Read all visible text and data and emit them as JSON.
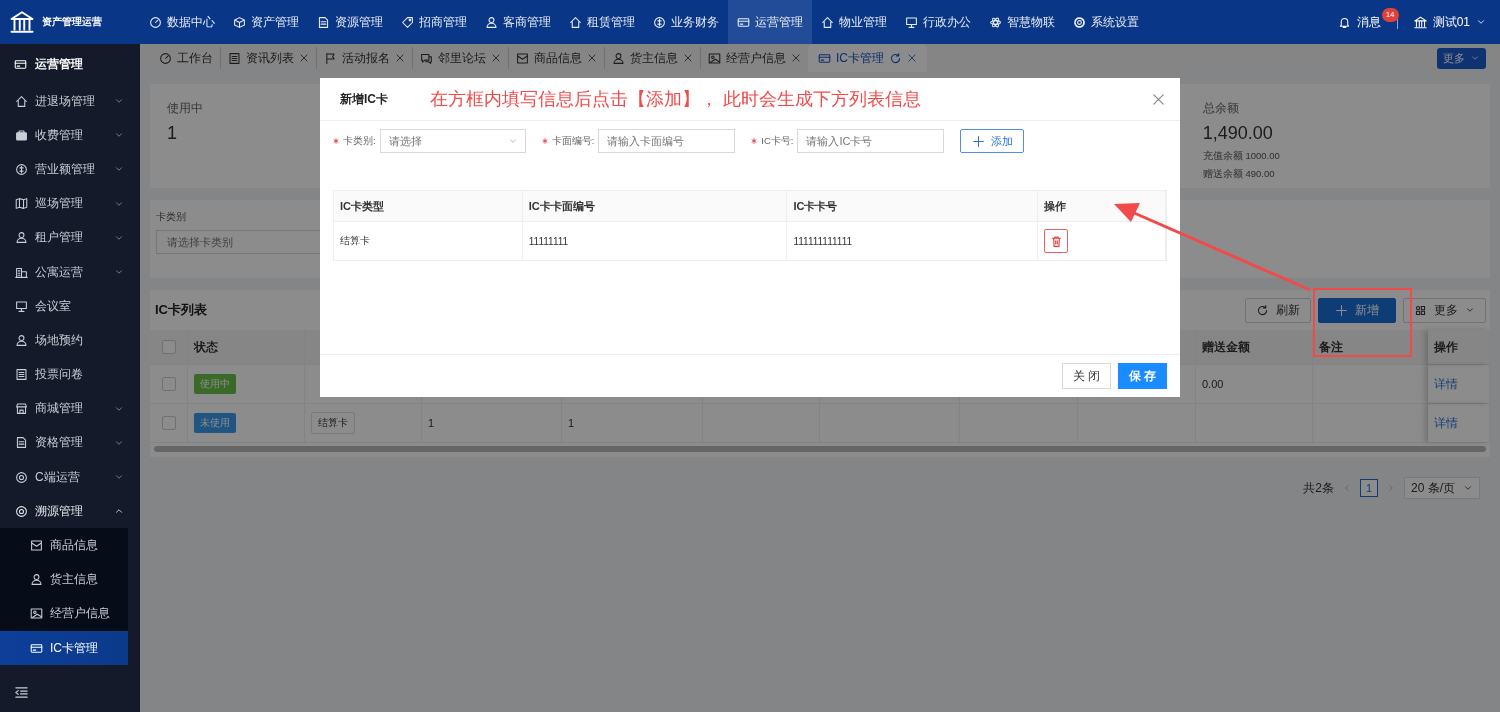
{
  "app": {
    "title": "资产管理运营"
  },
  "top_nav": [
    {
      "label": "数据中心",
      "selected": false
    },
    {
      "label": "资产管理",
      "selected": false
    },
    {
      "label": "资源管理",
      "selected": false
    },
    {
      "label": "招商管理",
      "selected": false
    },
    {
      "label": "客商管理",
      "selected": false
    },
    {
      "label": "租赁管理",
      "selected": false
    },
    {
      "label": "业务财务",
      "selected": false
    },
    {
      "label": "运营管理",
      "selected": true
    },
    {
      "label": "物业管理",
      "selected": false
    },
    {
      "label": "行政办公",
      "selected": false
    },
    {
      "label": "智慧物联",
      "selected": false
    },
    {
      "label": "系统设置",
      "selected": false
    }
  ],
  "messages": {
    "label": "消息",
    "badge": "14"
  },
  "user": {
    "name": "测试01"
  },
  "sidebar": {
    "title": "运营管理",
    "items": [
      {
        "label": "进退场管理",
        "kind": "group",
        "expanded": false
      },
      {
        "label": "收费管理",
        "kind": "group",
        "expanded": false
      },
      {
        "label": "营业额管理",
        "kind": "group",
        "expanded": false
      },
      {
        "label": "巡场管理",
        "kind": "group",
        "expanded": false
      },
      {
        "label": "租户管理",
        "kind": "group",
        "expanded": false
      },
      {
        "label": "公寓运营",
        "kind": "group",
        "expanded": false
      },
      {
        "label": "会议室",
        "kind": "link",
        "expanded": false
      },
      {
        "label": "场地预约",
        "kind": "link",
        "expanded": false
      },
      {
        "label": "投票问卷",
        "kind": "link",
        "expanded": false
      },
      {
        "label": "商城管理",
        "kind": "group",
        "expanded": false
      },
      {
        "label": "资格管理",
        "kind": "group",
        "expanded": false
      },
      {
        "label": "C端运营",
        "kind": "group",
        "expanded": false
      },
      {
        "label": "溯源管理",
        "kind": "group",
        "expanded": true,
        "children": [
          {
            "label": "商品信息",
            "selected": false
          },
          {
            "label": "货主信息",
            "selected": false
          },
          {
            "label": "经营户信息",
            "selected": false
          },
          {
            "label": "IC卡管理",
            "selected": true
          }
        ]
      }
    ]
  },
  "tabs": [
    {
      "label": "工作台",
      "closable": false,
      "selected": false
    },
    {
      "label": "资讯列表",
      "closable": true,
      "selected": false
    },
    {
      "label": "活动报名",
      "closable": true,
      "selected": false
    },
    {
      "label": "邻里论坛",
      "closable": true,
      "selected": false
    },
    {
      "label": "商品信息",
      "closable": true,
      "selected": false
    },
    {
      "label": "货主信息",
      "closable": true,
      "selected": false
    },
    {
      "label": "经营户信息",
      "closable": true,
      "selected": false
    },
    {
      "label": "IC卡管理",
      "closable": true,
      "selected": true
    }
  ],
  "tabs_more": "更多",
  "stats": [
    {
      "label": "使用中",
      "value": "1"
    },
    {
      "label": "总余额",
      "value": "1,490.00",
      "details": [
        "充值余额 1000.00",
        "赠送余额 490.00"
      ]
    }
  ],
  "filter": {
    "label": "卡类别",
    "placeholder": "请选择卡类别"
  },
  "card_list": {
    "title": "IC卡列表",
    "buttons": [
      {
        "label": "刷新",
        "kind": "refresh"
      },
      {
        "label": "新增",
        "kind": "primary"
      },
      {
        "label": "更多",
        "kind": "more"
      }
    ],
    "header": {
      "checked": false,
      "status": "状态",
      "gift_amount": "赠送金额",
      "remark": "备注",
      "action": "操作"
    },
    "rows": [
      {
        "checked": false,
        "status": {
          "label": "使用中",
          "kind": "in_use"
        },
        "gift_amount": "0.00",
        "action": "详情"
      },
      {
        "checked": false,
        "status": {
          "label": "未使用",
          "kind": "unused"
        },
        "card_type": "结算卡",
        "col_3": "1",
        "col_4": "1",
        "action": "详情"
      }
    ]
  },
  "pagination": {
    "total": "共2条",
    "pages": [
      {
        "label": "1",
        "selected": true
      }
    ],
    "page_size": "20 条/页"
  },
  "dialog": {
    "title": "新增IC卡",
    "annotation": "在方框内填写信息后点击【添加】， 此时会生成下方列表信息",
    "fields": [
      {
        "label": "卡类别:",
        "required": true,
        "kind": "select",
        "placeholder": "请选择"
      },
      {
        "label": "卡面编号:",
        "required": true,
        "kind": "input",
        "placeholder": "请输入卡面编号"
      },
      {
        "label": "IC卡号:",
        "required": true,
        "kind": "input",
        "placeholder": "请输入IC卡号"
      }
    ],
    "add_button": "添加",
    "columns": [
      "IC卡类型",
      "IC卡卡面编号",
      "IC卡卡号",
      "操作"
    ],
    "rows": [
      {
        "type": "结算卡",
        "face_number": "11111111",
        "card_number": "111111111111"
      }
    ],
    "buttons": [
      {
        "label": "关 闭",
        "kind": "default"
      },
      {
        "label": "保 存",
        "kind": "primary"
      }
    ]
  }
}
